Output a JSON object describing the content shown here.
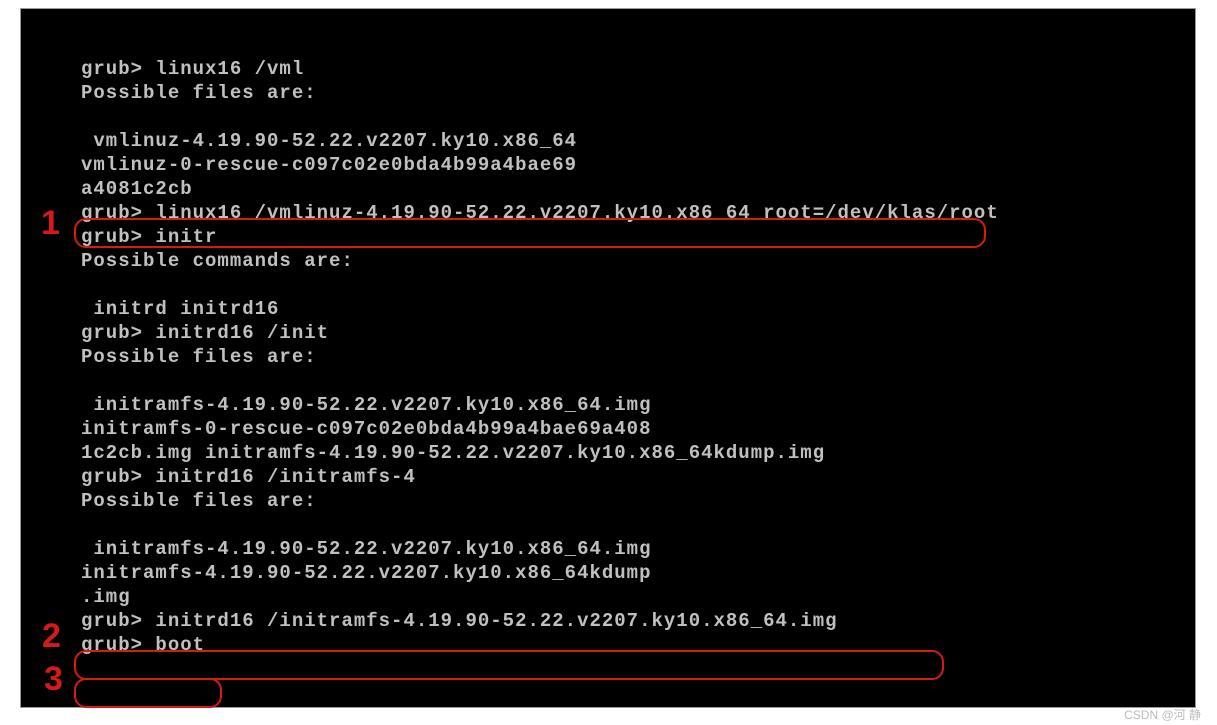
{
  "terminal": {
    "lines": {
      "l0": "grub> linux16 /vml",
      "l1": "Possible files are:",
      "l2": " vmlinuz-4.19.90-52.22.v2207.ky10.x86_64",
      "l3": "vmlinuz-0-rescue-c097c02e0bda4b99a4bae69",
      "l4": "a4081c2cb",
      "l5": "grub> linux16 /vmlinuz-4.19.90-52.22.v2207.ky10.x86_64 root=/dev/klas/root",
      "l6": "grub> initr",
      "l7": "Possible commands are:",
      "l8": " initrd initrd16",
      "l9": "grub> initrd16 /init",
      "l10": "Possible files are:",
      "l11": " initramfs-4.19.90-52.22.v2207.ky10.x86_64.img",
      "l12": "initramfs-0-rescue-c097c02e0bda4b99a4bae69a408",
      "l13": "1c2cb.img initramfs-4.19.90-52.22.v2207.ky10.x86_64kdump.img",
      "l14": "grub> initrd16 /initramfs-4",
      "l15": "Possible files are:",
      "l16": " initramfs-4.19.90-52.22.v2207.ky10.x86_64.img",
      "l17": "initramfs-4.19.90-52.22.v2207.ky10.x86_64kdump",
      "l18": ".img",
      "l19": "grub> initrd16 /initramfs-4.19.90-52.22.v2207.ky10.x86_64.img",
      "l20": "grub> boot"
    }
  },
  "annotations": {
    "num1": "1",
    "num2": "2",
    "num3": "3"
  },
  "watermark": "CSDN @河 静"
}
